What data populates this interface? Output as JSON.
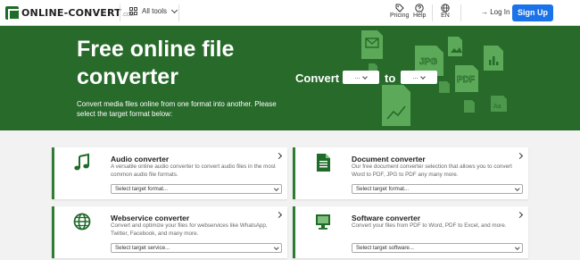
{
  "header": {
    "logo_text": "ONLINE-CONVERT",
    "logo_suffix": ".COM",
    "all_tools_label": "All tools",
    "pricing_label": "Pricing",
    "help_label": "Help",
    "language_label": "EN",
    "login_label": "Log In",
    "signup_label": "Sign Up"
  },
  "hero": {
    "title_line1": "Free online file",
    "title_line2": "converter",
    "description": "Convert media files online from one format into another. Please select the target format below:",
    "convert_label": "Convert",
    "to_label": "to",
    "from_select_value": "...",
    "to_select_value": "...",
    "deco_labels": {
      "jpg": "JPG",
      "pdf": "PDF",
      "aa": "Aa"
    }
  },
  "cards": [
    {
      "title": "Audio converter",
      "description": "A versatile online audio converter to convert audio files in the most common audio file formats.",
      "select_value": "Select target format...",
      "icon": "music-note-icon"
    },
    {
      "title": "Document converter",
      "description": "Our free document converter selection that allows you to convert Word to PDF, JPG to PDF any many more.",
      "select_value": "Select target format...",
      "icon": "document-icon"
    },
    {
      "title": "Webservice converter",
      "description": "Convert and optimize your files for webservices like WhatsApp, Twitter, Facebook, and many more.",
      "select_value": "Select target service...",
      "icon": "globe-icon"
    },
    {
      "title": "Software converter",
      "description": "Convert your files from PDF to Word, PDF to Excel, and more.",
      "select_value": "Select target software...",
      "icon": "monitor-icon"
    }
  ],
  "colors": {
    "brand_green": "#276a2a",
    "accent_blue": "#1a73e8",
    "card_border": "#2e7d32"
  }
}
